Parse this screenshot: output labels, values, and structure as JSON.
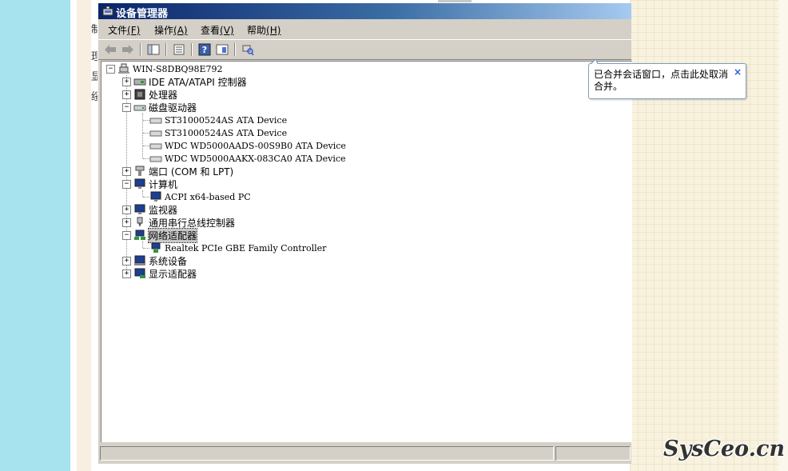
{
  "window": {
    "title": "设备管理器"
  },
  "background": {
    "side_chars": [
      "制",
      "理",
      "显",
      "绥"
    ]
  },
  "menu": [
    {
      "label": "文件",
      "accel": "(F)"
    },
    {
      "label": "操作",
      "accel": "(A)"
    },
    {
      "label": "查看",
      "accel": "(V)"
    },
    {
      "label": "帮助",
      "accel": "(H)"
    }
  ],
  "toolbar": {
    "icons": [
      "back-arrow-icon",
      "forward-arrow-icon",
      "show-hide-tree-icon",
      "properties-icon",
      "help-icon",
      "export-list-icon",
      "scan-hardware-icon"
    ]
  },
  "tree": {
    "root": "WIN-S8DBQ98E792",
    "categories": [
      {
        "label": "IDE ATA/ATAPI 控制器",
        "expanded": false,
        "children": []
      },
      {
        "label": "处理器",
        "expanded": false,
        "children": []
      },
      {
        "label": "磁盘驱动器",
        "expanded": true,
        "children": [
          "ST31000524AS ATA Device",
          "ST31000524AS ATA Device",
          "WDC WD5000AADS-00S9B0 ATA Device",
          "WDC WD5000AAKX-083CA0 ATA Device"
        ]
      },
      {
        "label": "端口 (COM 和 LPT)",
        "expanded": false,
        "children": []
      },
      {
        "label": "计算机",
        "expanded": true,
        "children": [
          "ACPI x64-based PC"
        ]
      },
      {
        "label": "监视器",
        "expanded": false,
        "children": []
      },
      {
        "label": "通用串行总线控制器",
        "expanded": false,
        "children": []
      },
      {
        "label": "网络适配器",
        "expanded": true,
        "selected": true,
        "children": [
          "Realtek PCIe GBE Family Controller"
        ]
      },
      {
        "label": "系统设备",
        "expanded": false,
        "children": []
      },
      {
        "label": "显示适配器",
        "expanded": false,
        "children": []
      }
    ]
  },
  "balloon": {
    "text": "已合并会话窗口，点击此处取消合并。",
    "close": "×"
  },
  "watermark": "SysCeo.cn",
  "colors": {
    "title_start": "#0a246a",
    "title_end": "#a6caf0",
    "left_band": "#a6e3ef",
    "cream": "#f8f2df"
  }
}
